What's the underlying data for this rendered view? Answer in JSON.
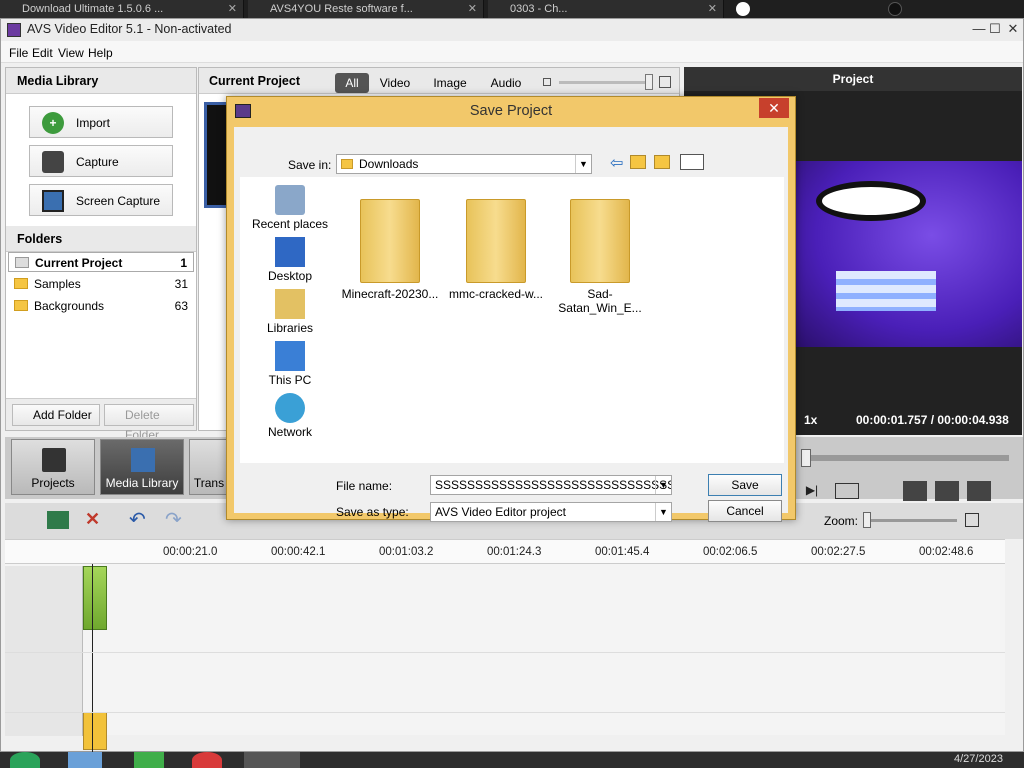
{
  "browser_tabs": [
    {
      "title": "Download Ultimate 1.5.0.6 ..."
    },
    {
      "title": "AVS4YOU Reste software f..."
    },
    {
      "title": "0303 - Ch..."
    }
  ],
  "app": {
    "title": "AVS Video Editor 5.1 - Non-activated",
    "menu": [
      "File",
      "Edit",
      "View",
      "Help"
    ]
  },
  "media_library": {
    "header": "Media Library",
    "buttons": [
      "Import",
      "Capture",
      "Screen Capture"
    ],
    "folders_header": "Folders",
    "folders": [
      {
        "name": "Current Project",
        "count": "1"
      },
      {
        "name": "Samples",
        "count": "31"
      },
      {
        "name": "Backgrounds",
        "count": "63"
      }
    ],
    "add_folder": "Add Folder",
    "delete_folder": "Delete Folder"
  },
  "current_project": {
    "header": "Current Project",
    "filters": [
      "All",
      "Video",
      "Image",
      "Audio"
    ],
    "active_filter": "All"
  },
  "preview": {
    "header": "Project",
    "speed": "1x",
    "time": "00:00:01.757 / 00:00:04.938"
  },
  "nav": {
    "projects": "Projects",
    "media_library": "Media Library",
    "transitions": "Trans"
  },
  "timeline": {
    "zoom_label": "Zoom:",
    "ticks": [
      "00:00:21.0",
      "00:00:42.1",
      "00:01:03.2",
      "00:01:24.3",
      "00:01:45.4",
      "00:02:06.5",
      "00:02:27.5",
      "00:02:48.6"
    ]
  },
  "dialog": {
    "title": "Save Project",
    "save_in_label": "Save in:",
    "save_in_value": "Downloads",
    "places": [
      "Recent places",
      "Desktop",
      "Libraries",
      "This PC",
      "Network"
    ],
    "files": [
      "Minecraft-20230...",
      "mmc-cracked-w...",
      "Sad-Satan_Win_E..."
    ],
    "file_name_label": "File name:",
    "file_name_value": "SSSSSSSSSSSSSSSSSSSSSSSSSSSSSSSSSS",
    "save_as_type_label": "Save as type:",
    "save_as_type_value": "AVS Video Editor project",
    "save_button": "Save",
    "cancel_button": "Cancel"
  },
  "taskbar": {
    "date": "4/27/2023"
  },
  "colors": {
    "dialog_frame": "#f2c86a",
    "close_red": "#c7402c",
    "preview_purple": "#5a2bd6"
  }
}
